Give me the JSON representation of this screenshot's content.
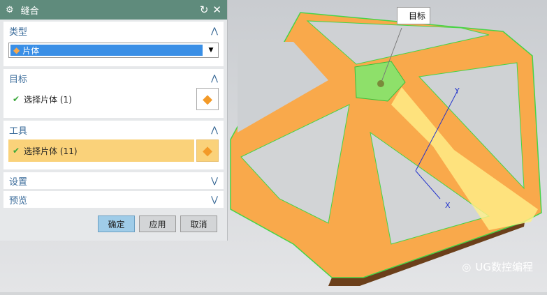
{
  "dialog": {
    "title": "缝合",
    "type_section": {
      "label": "类型",
      "selected": "片体"
    },
    "target_section": {
      "label": "目标",
      "select_label": "选择片体 (1)"
    },
    "tool_section": {
      "label": "工具",
      "select_label": "选择片体 (11)"
    },
    "settings_section": {
      "label": "设置"
    },
    "preview_section": {
      "label": "预览"
    },
    "buttons": {
      "ok": "确定",
      "apply": "应用",
      "cancel": "取消"
    }
  },
  "viewport": {
    "target_tag": "目标",
    "axis_x": "X",
    "axis_y": "Y",
    "watermark": "UG数控编程"
  },
  "colors": {
    "titlebar": "#5f8b7c",
    "body": "#f9a94b",
    "highlight": "#fad27a",
    "selected_face": "#8ee06a"
  }
}
